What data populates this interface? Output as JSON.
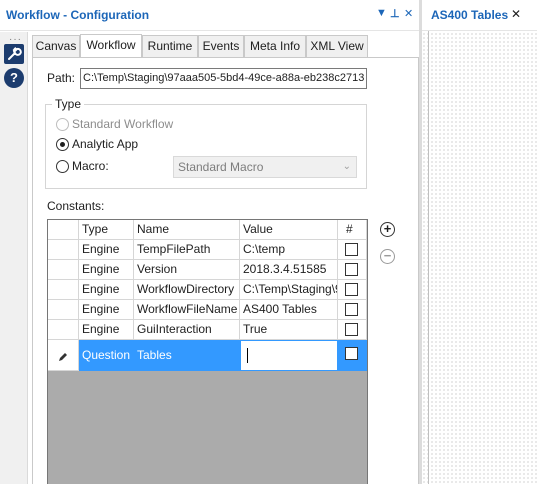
{
  "config": {
    "title": "Workflow - Configuration",
    "controls": {
      "dropdown": "▼",
      "pin": "⊥",
      "close": "✕"
    },
    "tools": [
      {
        "name": "wrench-icon",
        "glyph": "🔧"
      },
      {
        "name": "help-icon",
        "glyph": "?"
      }
    ],
    "tabs": [
      "Canvas",
      "Workflow",
      "Runtime",
      "Events",
      "Meta Info",
      "XML View"
    ],
    "active_tab": "Workflow",
    "path_label": "Path:",
    "path_value": "C:\\Temp\\Staging\\97aaa505-5bd4-49ce-a88a-eb238c2713",
    "type_group": {
      "legend": "Type",
      "options": [
        {
          "label": "Standard Workflow",
          "checked": false,
          "disabled": true
        },
        {
          "label": "Analytic App",
          "checked": true,
          "disabled": false
        },
        {
          "label": "Macro:",
          "checked": false,
          "disabled": false
        }
      ],
      "macro_select_value": "Standard Macro"
    },
    "constants_label": "Constants:",
    "grid": {
      "headers": [
        "",
        "Type",
        "Name",
        "Value",
        "#"
      ],
      "rows": [
        {
          "type": "Engine",
          "name": "TempFilePath",
          "value": "C:\\temp",
          "checked": false
        },
        {
          "type": "Engine",
          "name": "Version",
          "value": "2018.3.4.51585",
          "checked": false
        },
        {
          "type": "Engine",
          "name": "WorkflowDirectory",
          "value": "C:\\Temp\\Staging\\9",
          "checked": false
        },
        {
          "type": "Engine",
          "name": "WorkflowFileName",
          "value": "AS400 Tables",
          "checked": false
        },
        {
          "type": "Engine",
          "name": "GuiInteraction",
          "value": "True",
          "checked": false
        },
        {
          "type": "Question",
          "name": "Tables",
          "value": "",
          "checked": false,
          "selected": true
        }
      ]
    },
    "add_button": "+",
    "remove_button": "−"
  },
  "right_tab": {
    "title": "AS400 Tables",
    "close": "✕"
  },
  "colors": {
    "accent": "#1c66b8",
    "selection": "#3399ff",
    "grid_empty": "#ababab"
  }
}
